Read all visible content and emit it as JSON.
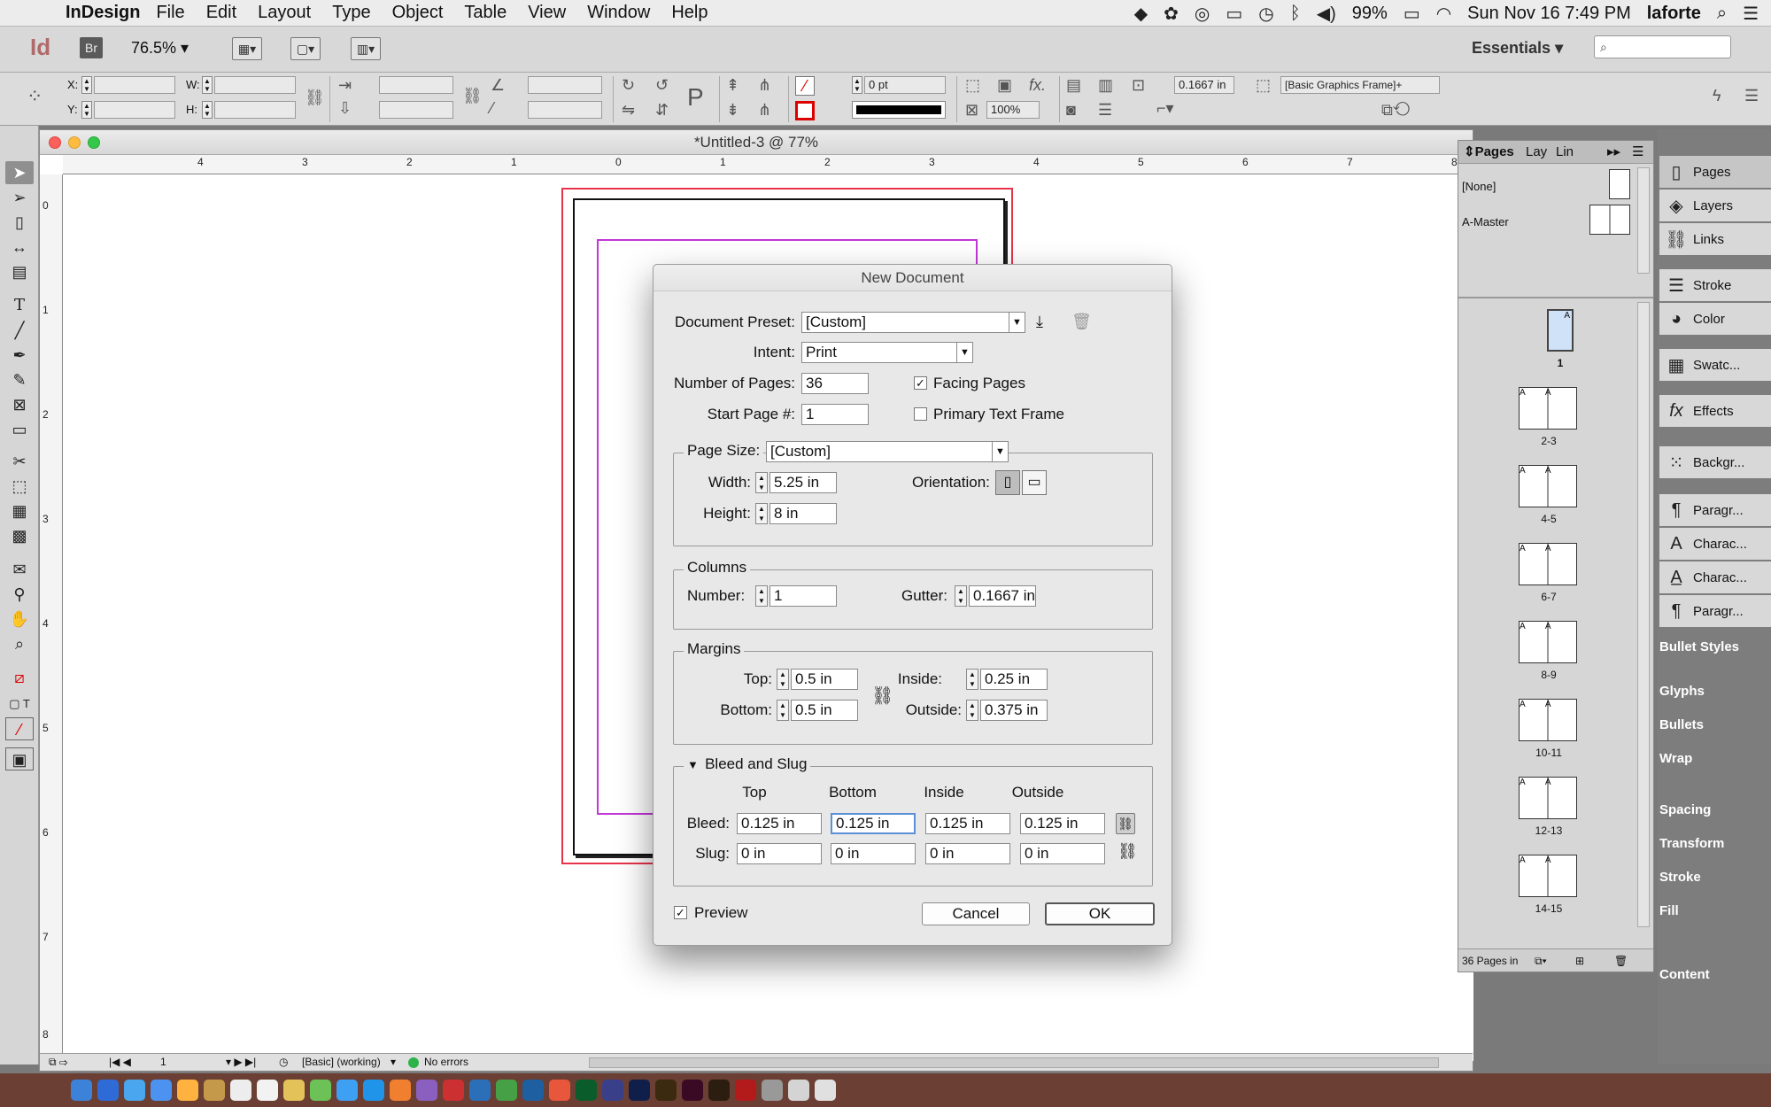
{
  "menubar": {
    "app_name": "InDesign",
    "items": [
      "File",
      "Edit",
      "Layout",
      "Type",
      "Object",
      "Table",
      "View",
      "Window",
      "Help"
    ],
    "battery": "99%",
    "datetime": "Sun Nov 16  7:49 PM",
    "user": "laforte"
  },
  "appbar": {
    "logo": "Id",
    "bridge": "Br",
    "zoom": "76.5%",
    "workspace": "Essentials",
    "search_placeholder": ""
  },
  "controlbar": {
    "x_label": "X:",
    "y_label": "Y:",
    "w_label": "W:",
    "h_label": "H:",
    "stroke_weight": "0 pt",
    "opacity": "100%",
    "gutter_value": "0.1667 in",
    "object_style": "[Basic Graphics Frame]+"
  },
  "document": {
    "title": "*Untitled-3 @ 77%",
    "h_ruler_labels": [
      "4",
      "3",
      "2",
      "1",
      "0",
      "1",
      "2",
      "3",
      "4",
      "5",
      "6",
      "7",
      "8"
    ],
    "v_ruler_labels": [
      "0",
      "1",
      "2",
      "3",
      "4",
      "5",
      "6",
      "7",
      "8"
    ],
    "status_page": "1",
    "status_profile": "[Basic] (working)",
    "status_errors": "No errors"
  },
  "dialog": {
    "title": "New Document",
    "document_preset_label": "Document Preset:",
    "document_preset_value": "[Custom]",
    "intent_label": "Intent:",
    "intent_value": "Print",
    "num_pages_label": "Number of Pages:",
    "num_pages_value": "36",
    "facing_pages_label": "Facing Pages",
    "facing_pages_checked": true,
    "start_page_label": "Start Page #:",
    "start_page_value": "1",
    "primary_text_frame_label": "Primary Text Frame",
    "primary_text_frame_checked": false,
    "page_size_label": "Page Size:",
    "page_size_value": "[Custom]",
    "width_label": "Width:",
    "width_value": "5.25 in",
    "height_label": "Height:",
    "height_value": "8 in",
    "orientation_label": "Orientation:",
    "columns_legend": "Columns",
    "number_label": "Number:",
    "number_value": "1",
    "gutter_label": "Gutter:",
    "gutter_value": "0.1667 in",
    "margins_legend": "Margins",
    "top_label": "Top:",
    "top_value": "0.5 in",
    "bottom_label": "Bottom:",
    "bottom_value": "0.5 in",
    "inside_label": "Inside:",
    "inside_value": "0.25 in",
    "outside_label": "Outside:",
    "outside_value": "0.375 in",
    "bleed_slug_legend": "Bleed and Slug",
    "col_headers": [
      "Top",
      "Bottom",
      "Inside",
      "Outside"
    ],
    "bleed_label": "Bleed:",
    "bleed_values": [
      "0.125 in",
      "0.125 in",
      "0.125 in",
      "0.125 in"
    ],
    "slug_label": "Slug:",
    "slug_values": [
      "0 in",
      "0 in",
      "0 in",
      "0 in"
    ],
    "preview_label": "Preview",
    "preview_checked": true,
    "cancel_label": "Cancel",
    "ok_label": "OK"
  },
  "pages_panel": {
    "tabs": [
      "Pages",
      "Lay",
      "Lin"
    ],
    "masters": [
      "[None]",
      "A-Master"
    ],
    "spreads": [
      "1",
      "2-3",
      "4-5",
      "6-7",
      "8-9",
      "10-11",
      "12-13",
      "14-15"
    ],
    "footer": "36 Pages in"
  },
  "panel_strip": {
    "buttons": [
      "Pages",
      "Layers",
      "Links",
      "Stroke",
      "Color",
      "Swatc...",
      "Effects",
      "Backgr...",
      "Paragr...",
      "Charac...",
      "Charac...",
      "Paragr..."
    ],
    "lower": [
      "Bullet Styles",
      "Glyphs",
      "Bullets",
      "Wrap",
      "Spacing",
      "Transform",
      "Stroke",
      "Fill",
      "Content"
    ]
  },
  "colors": {
    "bleed_guide": "#e8324a",
    "margin_guide": "#c237d6",
    "focus_ring": "#5b8fd6",
    "dock_bg": "#6b3f33"
  }
}
